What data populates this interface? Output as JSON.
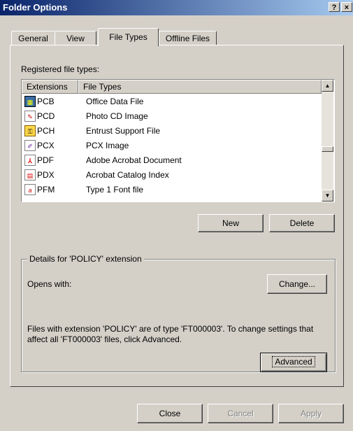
{
  "window": {
    "title": "Folder Options"
  },
  "title_buttons": {
    "help": "?",
    "close": "×"
  },
  "tabs": [
    {
      "label": "General"
    },
    {
      "label": "View"
    },
    {
      "label": "File Types"
    },
    {
      "label": "Offline Files"
    }
  ],
  "registered_label": "Registered file types:",
  "list": {
    "headers": {
      "extensions": "Extensions",
      "file_types": "File Types"
    },
    "rows": [
      {
        "ext": "PCB",
        "type": "Office Data File",
        "icon": "office-data-icon"
      },
      {
        "ext": "PCD",
        "type": "Photo CD Image",
        "icon": "photo-cd-icon"
      },
      {
        "ext": "PCH",
        "type": "Entrust Support File",
        "icon": "key-file-icon"
      },
      {
        "ext": "PCX",
        "type": "PCX Image",
        "icon": "paint-image-icon"
      },
      {
        "ext": "PDF",
        "type": "Adobe Acrobat Document",
        "icon": "acrobat-document-icon"
      },
      {
        "ext": "PDX",
        "type": "Acrobat Catalog Index",
        "icon": "acrobat-catalog-icon"
      },
      {
        "ext": "PFM",
        "type": "Type 1 Font file",
        "icon": "font-file-icon"
      }
    ]
  },
  "buttons": {
    "new": "New",
    "delete": "Delete",
    "change": "Change...",
    "advanced": "Advanced",
    "close": "Close",
    "cancel": "Cancel",
    "apply": "Apply"
  },
  "details": {
    "legend": "Details for 'POLICY' extension",
    "opens_with": "Opens with:",
    "description": "Files with extension 'POLICY' are of type 'FT000003'.  To change settings that affect all 'FT000003' files, click Advanced."
  },
  "colors": {
    "titlebar_start": "#0a246a",
    "titlebar_end": "#a6caf0",
    "face": "#d4d0c8"
  }
}
